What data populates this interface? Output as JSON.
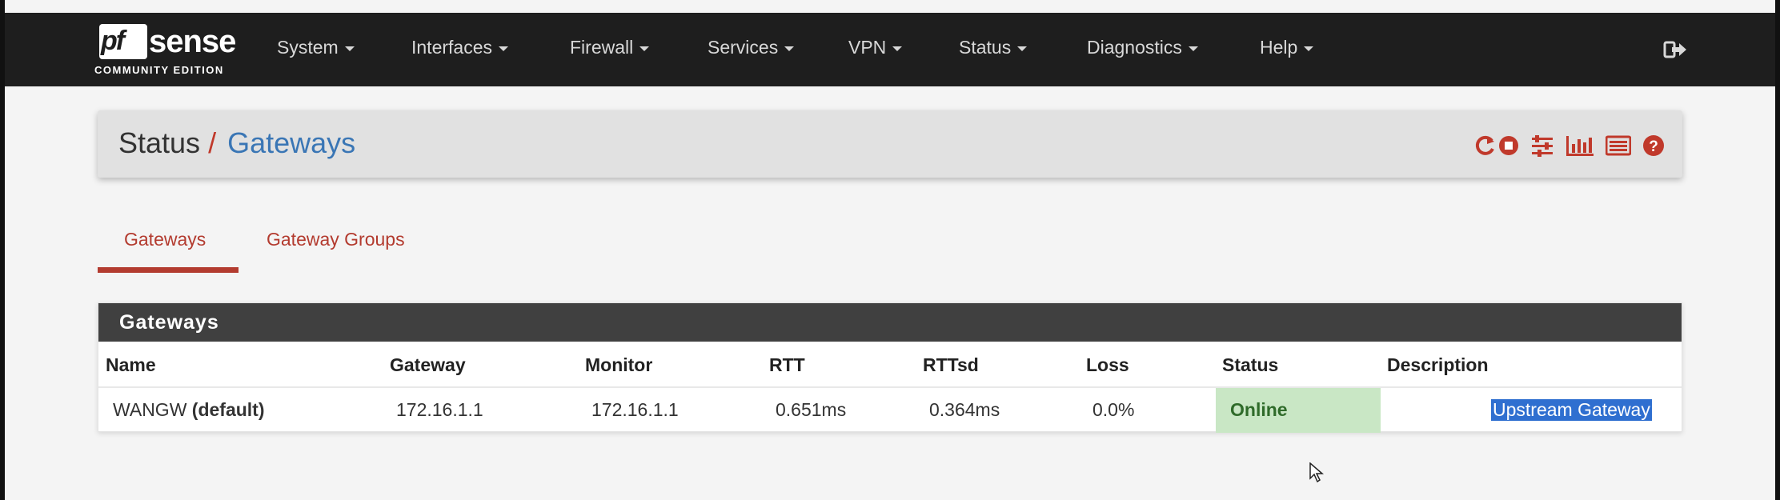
{
  "brand": {
    "name_pf": "pf",
    "name_sense": "sense",
    "edition": "COMMUNITY EDITION"
  },
  "nav": {
    "items": [
      {
        "label": "System"
      },
      {
        "label": "Interfaces"
      },
      {
        "label": "Firewall"
      },
      {
        "label": "Services"
      },
      {
        "label": "VPN"
      },
      {
        "label": "Status"
      },
      {
        "label": "Diagnostics"
      },
      {
        "label": "Help"
      }
    ]
  },
  "breadcrumb": {
    "section": "Status",
    "separator": "/",
    "page": "Gateways"
  },
  "toolbar_icons": [
    "reload-icon",
    "stop-icon",
    "settings-icon",
    "chart-icon",
    "log-icon",
    "help-icon"
  ],
  "tabs": [
    {
      "label": "Gateways",
      "active": true
    },
    {
      "label": "Gateway Groups",
      "active": false
    }
  ],
  "gateways_panel": {
    "title": "Gateways",
    "columns": [
      "Name",
      "Gateway",
      "Monitor",
      "RTT",
      "RTTsd",
      "Loss",
      "Status",
      "Description"
    ],
    "rows": [
      {
        "name": "WANGW",
        "name_suffix": "(default)",
        "gateway": "172.16.1.1",
        "monitor": "172.16.1.1",
        "rtt": "0.651ms",
        "rttsd": "0.364ms",
        "loss": "0.0%",
        "status": "Online",
        "description": "Upstream Gateway"
      }
    ]
  },
  "colors": {
    "navbar": "#1e1e1e",
    "accent_red": "#b33b2f",
    "link_blue": "#3a76b5",
    "online_bg": "#c9e7c5",
    "panel_head": "#404040"
  }
}
